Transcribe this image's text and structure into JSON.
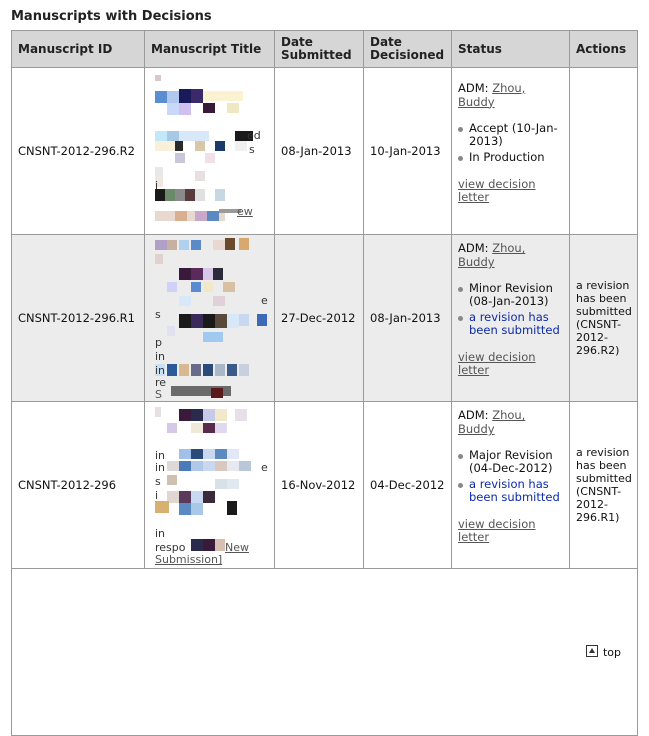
{
  "page": {
    "section_title": "Manuscripts with Decisions",
    "top_link": "top",
    "top_icon": "arrow-up-icon"
  },
  "table": {
    "headers": {
      "id": "Manuscript ID",
      "title": "Manuscript Title",
      "date_submitted": "Date Submitted",
      "date_decisioned": "Date Decisioned",
      "status": "Status",
      "actions": "Actions"
    },
    "rows": [
      {
        "id": "CNSNT-2012-296.R2",
        "title_fragments": [
          "ed",
          "s",
          "i",
          "ew"
        ],
        "date_submitted": "08-Jan-2013",
        "date_decisioned": "10-Jan-2013",
        "adm_label": "ADM:",
        "adm_name": "Zhou, Buddy",
        "status_1": "Accept (10-Jan-2013)",
        "status_2": "In Production",
        "view_letter": "view decision letter",
        "action": ""
      },
      {
        "id": "CNSNT-2012-296.R1",
        "title_fragments": [
          "ed",
          "s",
          "p",
          "in",
          "in",
          "re",
          "S"
        ],
        "date_submitted": "27-Dec-2012",
        "date_decisioned": "08-Jan-2013",
        "adm_label": "ADM:",
        "adm_name": "Zhou, Buddy",
        "status_1": "Minor Revision (08-Jan-2013)",
        "status_2": "a revision has been submitted",
        "view_letter": "view decision letter",
        "action": "a revision has been submitted (CNSNT-2012-296.R2)"
      },
      {
        "id": "CNSNT-2012-296",
        "title_fragments": [
          "ed",
          "s",
          "in",
          "in",
          "i",
          "in",
          "respo",
          "New",
          "Submission]"
        ],
        "date_submitted": "16-Nov-2012",
        "date_decisioned": "04-Dec-2012",
        "adm_label": "ADM:",
        "adm_name": "Zhou, Buddy",
        "status_1": "Major Revision (04-Dec-2012)",
        "status_2": "a revision has been submitted",
        "view_letter": "view decision letter",
        "action": "a revision has been submitted (CNSNT-2012-296.R1)"
      }
    ]
  }
}
